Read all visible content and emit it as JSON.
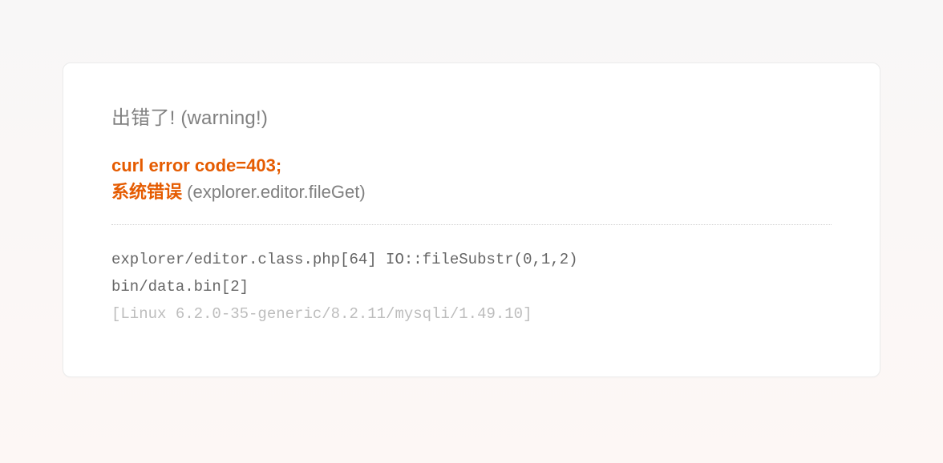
{
  "heading": "出错了! (warning!)",
  "error": {
    "code_line": "curl error code=403;",
    "system_error_label": "系统错误",
    "context": " (explorer.editor.fileGet)"
  },
  "stack": {
    "line1": "explorer/editor.class.php[64] IO::fileSubstr(0,1,2)",
    "line2": "bin/data.bin[2]",
    "env": "[Linux 6.2.0-35-generic/8.2.11/mysqli/1.49.10]"
  }
}
